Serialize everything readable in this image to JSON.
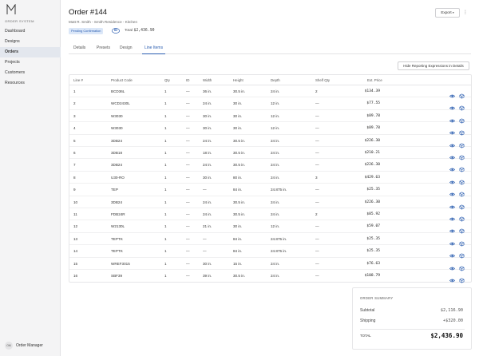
{
  "sidebar": {
    "system_title": "ORDER SYSTEM",
    "items": [
      {
        "label": "Dashboard",
        "active": false
      },
      {
        "label": "Designs",
        "active": false
      },
      {
        "label": "Orders",
        "active": true
      },
      {
        "label": "Projects",
        "active": false
      },
      {
        "label": "Customers",
        "active": false
      },
      {
        "label": "Resources",
        "active": false
      }
    ],
    "user": {
      "initials": "OM",
      "name": "Order Manager"
    }
  },
  "header": {
    "title": "Order #144",
    "subtitle": "Matt R. Smith - Smith Residence - Kitchen",
    "status": "Pending Confirmation",
    "revision": "R0",
    "total_label": "Total",
    "total_value": "$2,436.90",
    "export_label": "Export",
    "more_label": "⋮"
  },
  "tabs": [
    {
      "label": "Details",
      "active": false
    },
    {
      "label": "Presets",
      "active": false
    },
    {
      "label": "Design",
      "active": false
    },
    {
      "label": "Line Items",
      "active": true
    }
  ],
  "hide_button_label": "Hide Reporting Expressions in Details",
  "table": {
    "columns": [
      "Line #",
      "Product Code",
      "Qty",
      "ID",
      "Width",
      "Height",
      "Depth",
      "Shelf Qty",
      "Ext. Price"
    ],
    "rows": [
      [
        "1",
        "BCD36L",
        "1",
        "—",
        "36 in.",
        "30.5 in.",
        "24 in.",
        "2",
        "$134.39"
      ],
      [
        "2",
        "WCD2430L",
        "1",
        "—",
        "24 in.",
        "30 in.",
        "12 in.",
        "—",
        "$77.55"
      ],
      [
        "3",
        "W3030",
        "1",
        "—",
        "30 in.",
        "30 in.",
        "12 in.",
        "—",
        "$89.78"
      ],
      [
        "4",
        "W3030",
        "1",
        "—",
        "30 in.",
        "30 in.",
        "12 in.",
        "—",
        "$89.78"
      ],
      [
        "5",
        "3DB24",
        "1",
        "—",
        "24 in.",
        "30.5 in.",
        "24 in.",
        "—",
        "$226.30"
      ],
      [
        "6",
        "3DB18",
        "1",
        "—",
        "18 in.",
        "30.5 in.",
        "24 in.",
        "—",
        "$210.21"
      ],
      [
        "7",
        "3DB24",
        "1",
        "—",
        "24 in.",
        "30.5 in.",
        "24 in.",
        "—",
        "$226.30"
      ],
      [
        "8",
        "U30-RO",
        "1",
        "—",
        "30 in.",
        "80 in.",
        "24 in.",
        "3",
        "$429.63"
      ],
      [
        "9",
        "TEP",
        "1",
        "—",
        "—",
        "84 in.",
        "24.875 in.",
        "—",
        "$25.35"
      ],
      [
        "10",
        "3DB24",
        "1",
        "—",
        "24 in.",
        "30.5 in.",
        "24 in.",
        "—",
        "$226.30"
      ],
      [
        "11",
        "FDB24R",
        "1",
        "—",
        "24 in.",
        "30.5 in.",
        "24 in.",
        "2",
        "$85.92"
      ],
      [
        "12",
        "W2130L",
        "1",
        "—",
        "21 in.",
        "30 in.",
        "12 in.",
        "—",
        "$59.07"
      ],
      [
        "13",
        "TEPTK",
        "1",
        "—",
        "—",
        "84 in.",
        "24.875 in.",
        "—",
        "$25.35"
      ],
      [
        "14",
        "TEPTK",
        "1",
        "—",
        "—",
        "84 in.",
        "24.875 in.",
        "—",
        "$25.35"
      ],
      [
        "15",
        "WREF3015",
        "1",
        "—",
        "30 in.",
        "15 in.",
        "24 in.",
        "—",
        "$76.63"
      ],
      [
        "16",
        "SBF39",
        "1",
        "—",
        "39 in.",
        "30.5 in.",
        "24 in.",
        "—",
        "$108.79"
      ]
    ],
    "row_icons": [
      "eye-icon",
      "box-icon"
    ]
  },
  "summary": {
    "title": "ORDER SUMMARY",
    "subtotal_label": "Subtotal",
    "subtotal_value": "$2,116.90",
    "shipping_label": "Shipping",
    "shipping_value": "+$320.00",
    "total_label": "TOTAL",
    "total_value": "$2,436.90"
  },
  "colors": {
    "accent": "#2a5db0",
    "active_bg": "#e3e7ee",
    "badge_bg": "#dbe7f8"
  }
}
